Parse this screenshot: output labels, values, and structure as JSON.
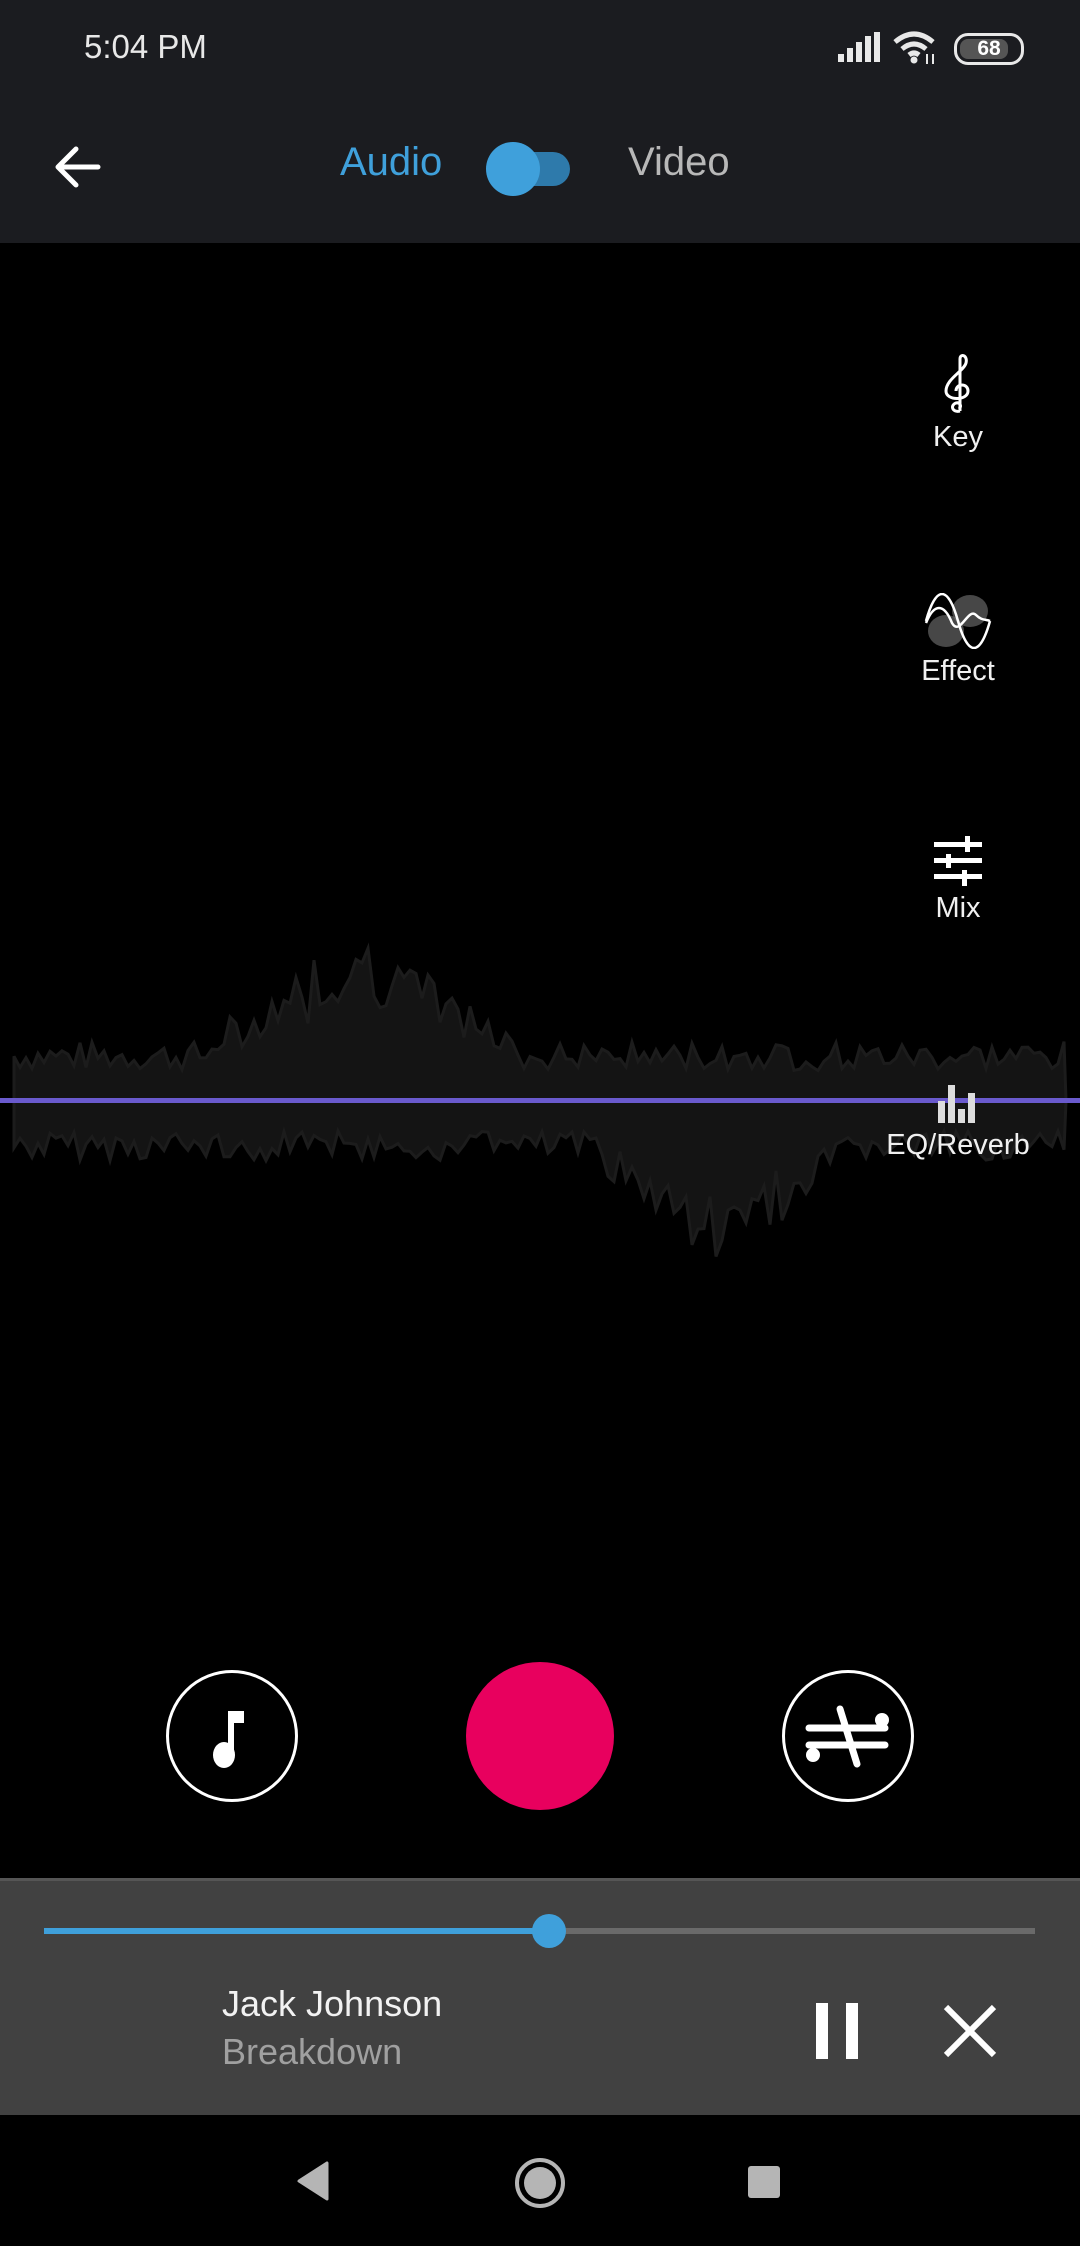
{
  "status_bar": {
    "time": "5:04 PM",
    "battery_level": "68",
    "icons": [
      "signal-icon",
      "wifi-icon",
      "battery-icon"
    ]
  },
  "header": {
    "back_icon": "arrow-left-icon",
    "tabs": [
      {
        "label": "Audio",
        "active": true
      },
      {
        "label": "Video",
        "active": false
      }
    ],
    "toggle_state": "audio"
  },
  "side_menu": {
    "items": [
      {
        "label": "Key",
        "icon": "treble-clef-icon"
      },
      {
        "label": "Effect",
        "icon": "wave-effect-icon"
      },
      {
        "label": "Mix",
        "icon": "sliders-icon"
      },
      {
        "label": "EQ/Reverb",
        "icon": "equalizer-icon"
      }
    ]
  },
  "controls": {
    "library_icon": "music-note-icon",
    "record_icon": "record-icon",
    "swap_icon": "swap-icon"
  },
  "player": {
    "artist": "Jack Johnson",
    "title": "Breakdown",
    "progress": 0.51,
    "pause_icon": "pause-icon",
    "close_icon": "close-icon"
  },
  "colors": {
    "accent": "#3fa0db",
    "record": "#e8005e",
    "waveform_line": "#6a5acd",
    "bar_bg": "#1b1c20",
    "player_bg": "#414141"
  },
  "nav_bar": {
    "icons": [
      "nav-back-icon",
      "nav-home-icon",
      "nav-recents-icon"
    ]
  }
}
